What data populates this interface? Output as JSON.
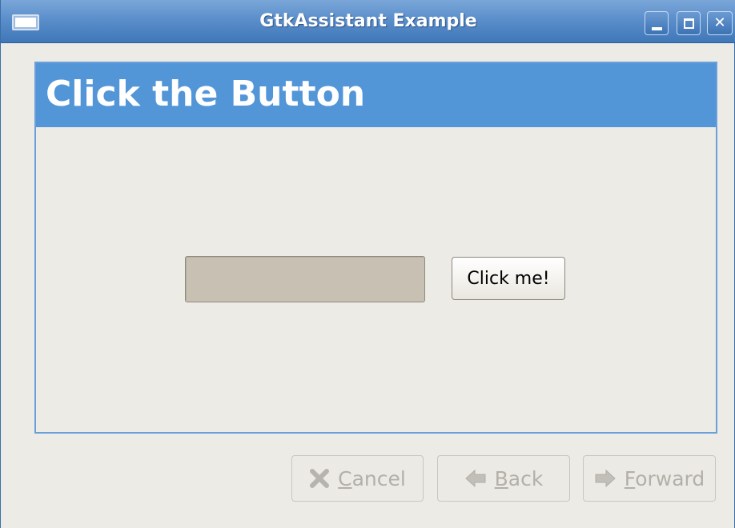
{
  "window": {
    "title": "GtkAssistant Example",
    "controls": {
      "minimize_icon": "minimize-icon",
      "maximize_icon": "maximize-icon",
      "close_icon": "close-icon"
    }
  },
  "page": {
    "title": "Click the Button",
    "header_color": "#5396d8"
  },
  "content": {
    "entry_value": "",
    "button_label": "Click me!"
  },
  "actions": {
    "cancel": {
      "mnemonic": "C",
      "rest": "ancel",
      "icon": "x-icon",
      "enabled": false
    },
    "back": {
      "mnemonic": "B",
      "rest": "ack",
      "icon": "arrow-left-icon",
      "enabled": false
    },
    "forward": {
      "mnemonic": "F",
      "rest": "orward",
      "icon": "arrow-right-icon",
      "enabled": false
    }
  }
}
